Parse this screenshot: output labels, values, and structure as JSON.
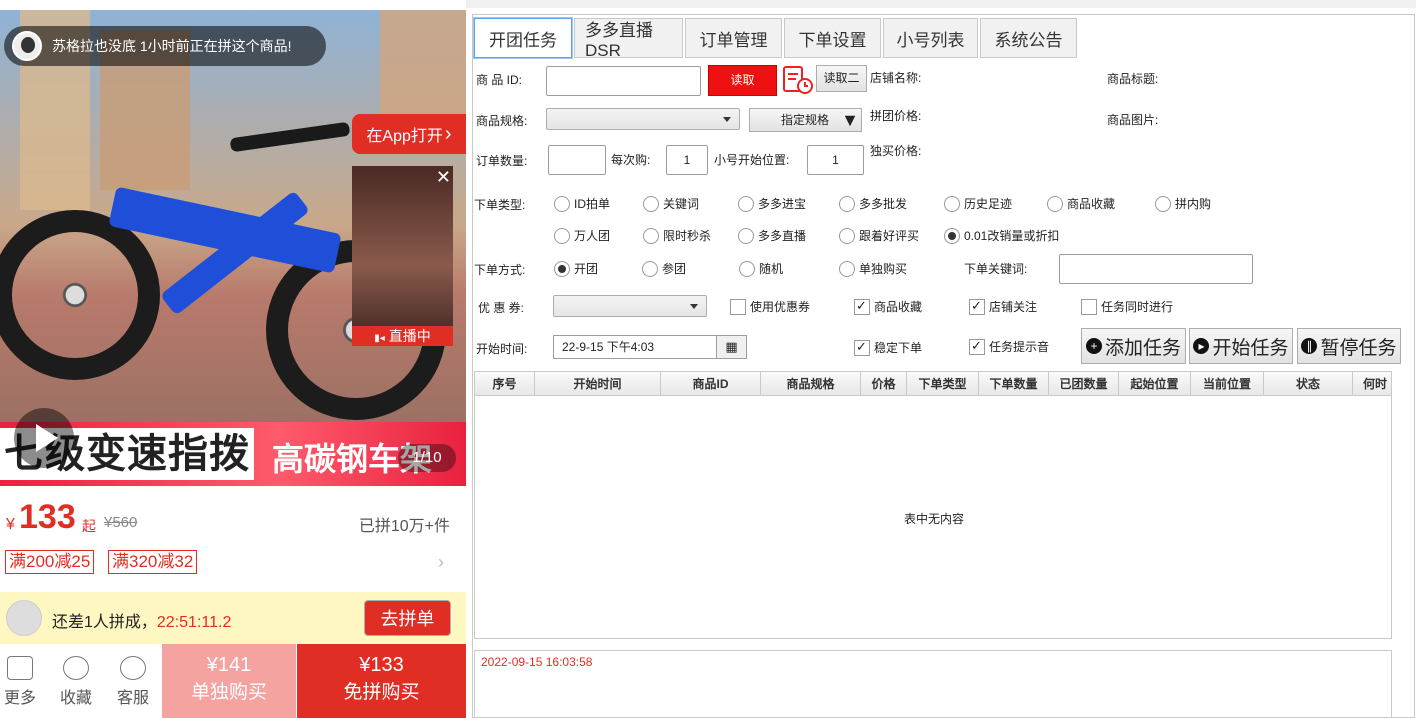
{
  "product": {
    "notice": "苏格拉也没底 1小时前正在拼这个商品!",
    "open_app": "在App打开",
    "live_badge": "直播中",
    "close": "✕",
    "banner_left": "七级变速指拨",
    "banner_right": "高碳钢车架",
    "pager": "1/10",
    "currency": "¥",
    "price": "133",
    "price_suffix": "起",
    "orig_price": "¥560",
    "sold": "已拼10万+件",
    "coupons": [
      "满200减25",
      "满320减32"
    ],
    "group_text_a": "还差1人拼成，",
    "group_time": "22:51:11.2",
    "group_btn": "去拼单",
    "tab_more": "更多",
    "tab_fav": "收藏",
    "tab_service": "客服",
    "single_price": "¥141",
    "single_label": "单独购买",
    "nogroup_price": "¥133",
    "nogroup_label": "免拼购买"
  },
  "app": {
    "tabs": [
      "开团任务",
      "多多直播DSR",
      "订单管理",
      "下单设置",
      "小号列表",
      "系统公告"
    ],
    "labels": {
      "product_id": "商 品 ID:",
      "read": "读取",
      "read2": "读取二",
      "shop_name": "店铺名称:",
      "product_title": "商品标题:",
      "spec": "商品规格:",
      "assign_spec": "指定规格",
      "group_price": "拼团价格:",
      "product_image": "商品图片:",
      "order_qty": "订单数量:",
      "each_buy": "每次购:",
      "start_pos": "小号开始位置:",
      "solo_price": "独买价格:",
      "order_type": "下单类型:",
      "order_way": "下单方式:",
      "order_keyword": "下单关键词:",
      "coupon": "优 惠 券:",
      "start_time": "开始时间:"
    },
    "each_buy_value": "1",
    "start_pos_value": "1",
    "order_types_row1": [
      "ID拍单",
      "关键词",
      "多多进宝",
      "多多批发",
      "历史足迹",
      "商品收藏",
      "拼内购"
    ],
    "order_types_row2": [
      "万人团",
      "限时秒杀",
      "多多直播",
      "跟着好评买",
      "0.01改销量或折扣"
    ],
    "order_ways": [
      "开团",
      "参团",
      "随机",
      "单独购买"
    ],
    "checks_row1": [
      "使用优惠券",
      "商品收藏",
      "店铺关注",
      "任务同时进行"
    ],
    "checks_row2": [
      "稳定下单",
      "任务提示音"
    ],
    "start_time_value": "22-9-15 下午4:03",
    "add_task": "添加任务",
    "start_task": "开始任务",
    "pause_task": "暂停任务",
    "columns": [
      "序号",
      "开始时间",
      "商品ID",
      "商品规格",
      "价格",
      "下单类型",
      "下单数量",
      "已团数量",
      "起始位置",
      "当前位置",
      "状态",
      "何时"
    ],
    "empty_text": "表中无内容",
    "log_text": "2022-09-15 16:03:58"
  },
  "colors": {
    "accent": "#e02e24",
    "tab_active_border": "#5fa3ea"
  }
}
